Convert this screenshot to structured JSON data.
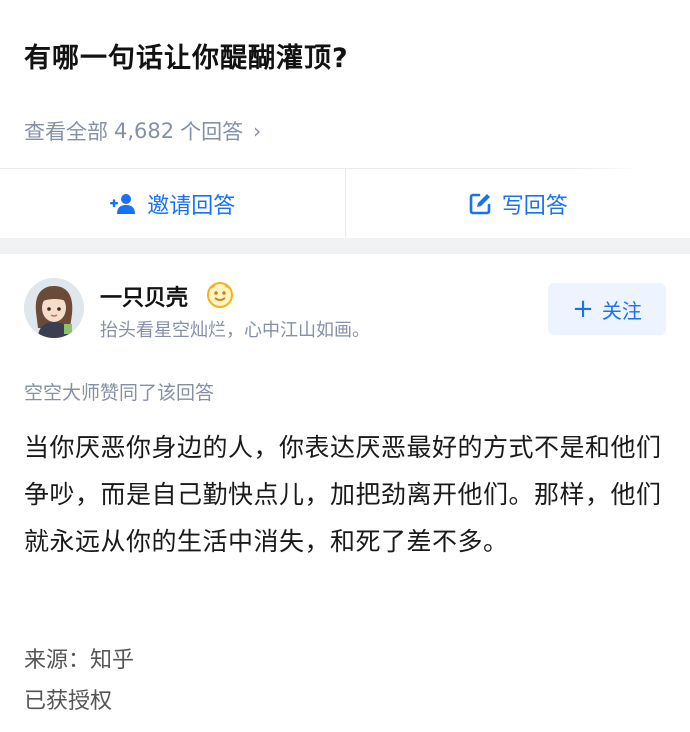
{
  "question": {
    "title": "有哪一句话让你醍醐灌顶?"
  },
  "view_all": {
    "prefix": "查看全部",
    "count": "4,682",
    "suffix": "个回答",
    "chevron": "›"
  },
  "actions": {
    "invite_label": "邀请回答",
    "invite_icon": "add-user-icon",
    "write_label": "写回答",
    "write_icon": "edit-icon"
  },
  "author": {
    "name": "一只贝壳",
    "bio": "抬头看星空灿烂，心中江山如画。",
    "avatar_icon": "avatar-girl",
    "badge_icon": "badge-icon"
  },
  "follow": {
    "plus": "+",
    "label": "关注"
  },
  "upvote_note": "空空大师赞同了该回答",
  "answer": {
    "body": "当你厌恶你身边的人，你表达厌恶最好的方式不是和他们争吵，而是自己勤快点儿，加把劲离开他们。那样，他们就永远从你的生活中消失，和死了差不多。"
  },
  "footer": {
    "source": "来源：知乎",
    "authorized": "已获授权"
  },
  "colors": {
    "brand_blue": "#1772f6",
    "muted_gray": "#8590a6",
    "follow_bg": "#eef4ff"
  }
}
